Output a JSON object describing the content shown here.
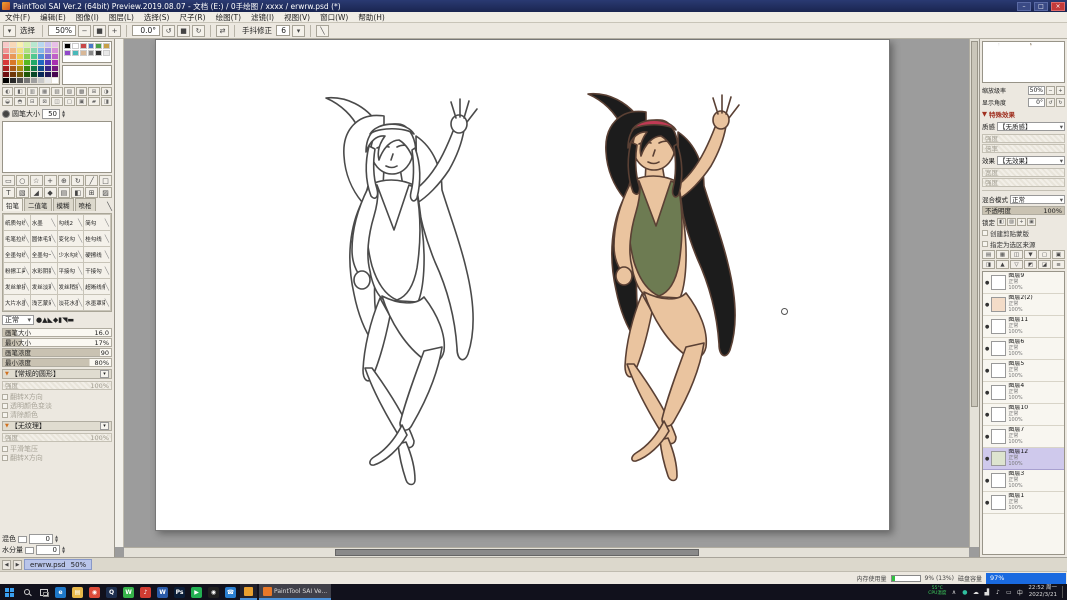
{
  "window": {
    "title": "PaintTool SAI Ver.2 (64bit) Preview.2019.08.07 - 文档 (E:) / 0手绘图 / xxxx / erwrw.psd (*)",
    "controls": {
      "minimize": "–",
      "maximize": "□",
      "close": "×"
    }
  },
  "menu": {
    "items": [
      "文件(F)",
      "编辑(E)",
      "图像(I)",
      "图层(L)",
      "选择(S)",
      "尺子(R)",
      "绘图(T)",
      "滤镜(I)",
      "视图(V)",
      "窗口(W)",
      "帮助(H)"
    ]
  },
  "toolbar": {
    "select_label": "选择",
    "zoom_value": "50%",
    "zoom_buttons": [
      "−",
      "■",
      "+"
    ],
    "angle_value": "0.0°",
    "angle_buttons": [
      "↺",
      "■",
      "↻"
    ],
    "stabilizer_label": "手抖修正",
    "stabilizer_value": "6"
  },
  "left_panel": {
    "palette_colors": [
      "#f8c8c8",
      "#f8d8b8",
      "#f8f0b0",
      "#d8f0b0",
      "#b8e8d0",
      "#b8d8f0",
      "#c8c0f0",
      "#e8c0e8",
      "#f09898",
      "#f0b888",
      "#f0e080",
      "#b0e080",
      "#88d8b0",
      "#88b8e8",
      "#a090e0",
      "#d890d8",
      "#e86868",
      "#e89858",
      "#e8d050",
      "#88d050",
      "#50c890",
      "#5090d8",
      "#7868d0",
      "#c060c8",
      "#d83838",
      "#d87828",
      "#d8b820",
      "#58b820",
      "#20a868",
      "#2068c0",
      "#5038b8",
      "#a830b0",
      "#a82020",
      "#a85818",
      "#a88810",
      "#388810",
      "#107848",
      "#104888",
      "#382888",
      "#781880",
      "#701010",
      "#703808",
      "#705808",
      "#205808",
      "#084828",
      "#082858",
      "#201858",
      "#480850",
      "#000000",
      "#282828",
      "#505050",
      "#787878",
      "#a0a0a0",
      "#c8c8c8",
      "#e8e8e8",
      "#ffffff"
    ],
    "mixer_colors": [
      "#000000",
      "#ffffff",
      "#c84848",
      "#4878c8",
      "#48a048",
      "#c8a048",
      "#9048c8",
      "#48b8b8",
      "#d8b898",
      "#888888",
      "#303030",
      "#e8e8e8"
    ],
    "utility_buttons": [
      {
        "name": "hue-ring-button",
        "glyph": "◐"
      },
      {
        "name": "hue-square-button",
        "glyph": "◧"
      },
      {
        "name": "slider-rgb-button",
        "glyph": "▥"
      },
      {
        "name": "slider-hsv-button",
        "glyph": "▦"
      },
      {
        "name": "swatch-panel-button",
        "glyph": "▧"
      },
      {
        "name": "mixer-panel-button",
        "glyph": "▨"
      },
      {
        "name": "paper-panel-button",
        "glyph": "▩"
      },
      {
        "name": "scratchpad-button",
        "glyph": "⊞"
      },
      {
        "name": "picker-button",
        "glyph": "◑"
      },
      {
        "name": "gray-scale-button",
        "glyph": "◒"
      },
      {
        "name": "tone-button",
        "glyph": "◓"
      },
      {
        "name": "grid-a-button",
        "glyph": "⊟"
      },
      {
        "name": "grid-b-button",
        "glyph": "⊠"
      },
      {
        "name": "grid-c-button",
        "glyph": "◫"
      },
      {
        "name": "grid-d-button",
        "glyph": "▢"
      },
      {
        "name": "grid-e-button",
        "glyph": "▣"
      },
      {
        "name": "grid-f-button",
        "glyph": "▰"
      },
      {
        "name": "grid-g-button",
        "glyph": "◨"
      }
    ],
    "brush_size_label": "圆笔大小",
    "brush_size_value": "50",
    "tools": [
      {
        "name": "selection-rect-tool",
        "glyph": "▭"
      },
      {
        "name": "lasso-tool",
        "glyph": "○"
      },
      {
        "name": "magic-wand-tool",
        "glyph": "☆"
      },
      {
        "name": "move-tool",
        "glyph": "+"
      },
      {
        "name": "zoom-tool",
        "glyph": "⊕"
      },
      {
        "name": "rotate-tool",
        "glyph": "↻"
      },
      {
        "name": "pen-tool",
        "glyph": "╱"
      },
      {
        "name": "eraser-tool",
        "glyph": "□"
      },
      {
        "name": "text-tool",
        "glyph": "T"
      },
      {
        "name": "gradient-tool",
        "glyph": "▧"
      },
      {
        "name": "bucket-tool",
        "glyph": "◢"
      },
      {
        "name": "shape-tool",
        "glyph": "◆"
      },
      {
        "name": "panel-a-tool",
        "glyph": "▤"
      },
      {
        "name": "panel-b-tool",
        "glyph": "◧"
      },
      {
        "name": "panel-c-tool",
        "glyph": "⊞"
      },
      {
        "name": "panel-d-tool",
        "glyph": "▨"
      }
    ],
    "brush_tabs": [
      "铅笔",
      "二值笔",
      "模糊",
      "喷枪"
    ],
    "brushes": [
      "纸质勾线",
      "水墨",
      "勾线2",
      "简勾",
      "毛笔拉线",
      "圆体毛笔",
      "变化勾",
      "桂勾线",
      "全墨勾线",
      "全墨勾一",
      "少水勾线",
      "硬擦线",
      "粉擦工具",
      "水彩阴影",
      "平接勾",
      "干接勾",
      "发丝单接",
      "发丝淡彩",
      "发丝稍接",
      "超晰线条",
      "大片水墨",
      "浅艺蒙染",
      "淡花水墨",
      "水墨罩染"
    ],
    "tip_mode": "正常",
    "tip_shapes": [
      "●",
      "▲",
      "◣",
      "◆",
      "▮",
      "◥",
      "▬"
    ],
    "sliders": [
      {
        "label": "画笔大小",
        "value": "16.0",
        "fill": 12
      },
      {
        "label": "最小大小",
        "value": "17%",
        "fill": 17
      },
      {
        "label": "画笔浓度",
        "value": "90",
        "fill": 90
      },
      {
        "label": "最小浓度",
        "value": "80%",
        "fill": 80
      }
    ],
    "shape_section": {
      "title": "【常规的圆形】",
      "strength_label": "强度",
      "strength_value": "100%",
      "options": [
        "翻转X方向",
        "透明颜色变淡",
        "清除颜色"
      ]
    },
    "texture_section": {
      "title": "【无纹理】",
      "strength_label": "强度",
      "strength_value": "100%",
      "options": [
        "平滑笔压",
        "翻转X方向"
      ]
    },
    "mix_label": "混色",
    "mix_value": "0",
    "water_label": "水分量",
    "water_value": "0"
  },
  "canvas": {
    "artwork_description": "两个跳跃姿势的长发女性人物：左侧为铅笔线稿，右侧为上色稿（黑发、红色发带、绿色连体泳衣）",
    "colors": {
      "hair": "#1c1c1c",
      "skin": "#eac49f",
      "swimsuit": "#6d7b52",
      "headband": "#c13a55",
      "lineart": "#4a4a4a"
    }
  },
  "right_panel": {
    "navigator": {
      "zoom_label": "缩放级率",
      "zoom_value": "50%",
      "angle_label": "显示角度",
      "angle_value": "0°"
    },
    "effects": {
      "header": "特殊效果",
      "texture_label": "质感",
      "texture_value": "【无质感】",
      "texture_rows": [
        {
          "label": "强度"
        },
        {
          "label": "倍率"
        }
      ],
      "effect_label": "效果",
      "effect_value": "【无效果】",
      "effect_rows": [
        {
          "label": "宽度"
        },
        {
          "label": "强度"
        }
      ]
    },
    "layer_props": {
      "blend_label": "混合模式",
      "blend_value": "正常",
      "opacity_label": "不透明度",
      "opacity_value": "100%",
      "lock_label": "锁定",
      "clip_label": "创建剪贴蒙版",
      "selsrc_label": "指定为选区来源"
    },
    "lock_icons": [
      {
        "name": "lock-transparency-icon",
        "glyph": "◧"
      },
      {
        "name": "lock-pixels-icon",
        "glyph": "▨"
      },
      {
        "name": "lock-position-icon",
        "glyph": "+"
      },
      {
        "name": "lock-all-icon",
        "glyph": "▣"
      }
    ],
    "layer_toolbar": [
      {
        "name": "new-layer-button",
        "glyph": "▤"
      },
      {
        "name": "new-folder-button",
        "glyph": "▦"
      },
      {
        "name": "duplicate-layer-button",
        "glyph": "◫"
      },
      {
        "name": "merge-down-button",
        "glyph": "▼"
      },
      {
        "name": "clear-layer-button",
        "glyph": "▢"
      },
      {
        "name": "delete-layer-button",
        "glyph": "▣"
      },
      {
        "name": "layer-mask-button",
        "glyph": "◨"
      },
      {
        "name": "move-layer-up-button",
        "glyph": "▲"
      },
      {
        "name": "move-layer-down-button",
        "glyph": "▽"
      },
      {
        "name": "lock-alpha-button",
        "glyph": "◩"
      },
      {
        "name": "paint-effect-button",
        "glyph": "◪"
      },
      {
        "name": "layer-settings-button",
        "glyph": "≡"
      }
    ],
    "layers": [
      {
        "name": "图层9",
        "mode": "正常",
        "opacity": "100%",
        "thumb": "#ffffff",
        "selected": false
      },
      {
        "name": "图层2(2)",
        "mode": "正常",
        "opacity": "100%",
        "thumb": "#f3dcc8",
        "selected": false
      },
      {
        "name": "图层11",
        "mode": "正常",
        "opacity": "100%",
        "thumb": "#ffffff",
        "selected": false
      },
      {
        "name": "图层6",
        "mode": "正常",
        "opacity": "100%",
        "thumb": "#ffffff",
        "selected": false
      },
      {
        "name": "图层5",
        "mode": "正常",
        "opacity": "100%",
        "thumb": "#ffffff",
        "selected": false
      },
      {
        "name": "图层4",
        "mode": "正常",
        "opacity": "100%",
        "thumb": "#ffffff",
        "selected": false
      },
      {
        "name": "图层10",
        "mode": "正常",
        "opacity": "100%",
        "thumb": "#ffffff",
        "selected": false
      },
      {
        "name": "图层7",
        "mode": "正常",
        "opacity": "100%",
        "thumb": "#ffffff",
        "selected": false
      },
      {
        "name": "图层12",
        "mode": "正常",
        "opacity": "100%",
        "thumb": "#dde4cf",
        "selected": true
      },
      {
        "name": "图层3",
        "mode": "正常",
        "opacity": "100%",
        "thumb": "#ffffff",
        "selected": false
      },
      {
        "name": "图层1",
        "mode": "正常",
        "opacity": "100%",
        "thumb": "#ffffff",
        "selected": false
      }
    ]
  },
  "status_bar": {
    "doc_name": "erwrw.psd",
    "doc_zoom": "50%",
    "memory_label": "内存使用量",
    "memory_value": "9% (13%)",
    "disk_label": "磁盘容量",
    "disk_value": "97%"
  },
  "taskbar": {
    "apps": [
      {
        "name": "edge-icon",
        "color": "#1e78c8",
        "glyph": "e"
      },
      {
        "name": "file-explorer-icon",
        "color": "#e8b84a",
        "glyph": "▤"
      },
      {
        "name": "chrome-icon",
        "color": "#dd4b39",
        "glyph": "◉"
      },
      {
        "name": "qq-icon",
        "color": "#1d2e4e",
        "glyph": "Q"
      },
      {
        "name": "wechat-icon",
        "color": "#36b34a",
        "glyph": "W"
      },
      {
        "name": "netease-music-icon",
        "color": "#d23c32",
        "glyph": "♪"
      },
      {
        "name": "word-icon",
        "color": "#2a5aa8",
        "glyph": "W"
      },
      {
        "name": "photoshop-icon",
        "color": "#0c1e38",
        "glyph": "Ps"
      },
      {
        "name": "video-player-icon",
        "color": "#22b052",
        "glyph": "▶"
      },
      {
        "name": "github-icon",
        "color": "#202020",
        "glyph": "◉"
      },
      {
        "name": "phone-link-icon",
        "color": "#2a7fd0",
        "glyph": "☎"
      }
    ],
    "windows": [
      {
        "name": "image-viewer-window-button",
        "color": "#e8a030",
        "label": "",
        "active": false
      },
      {
        "name": "sai-window-button",
        "color": "#e87828",
        "label": "PaintTool SAI Ve...",
        "active": true
      }
    ],
    "tray": {
      "badge_line1": "55°C",
      "badge_line2": "CPU温度",
      "icons": [
        {
          "name": "hidden-icons-chevron",
          "glyph": "∧",
          "color": "#dddddd"
        },
        {
          "name": "tray-security-icon",
          "glyph": "●",
          "color": "#30c0a0"
        },
        {
          "name": "tray-cloud-icon",
          "glyph": "☁",
          "color": "#dddddd"
        },
        {
          "name": "network-icon",
          "glyph": "▟",
          "color": "#dddddd"
        },
        {
          "name": "volume-icon",
          "glyph": "♪",
          "color": "#dddddd"
        },
        {
          "name": "battery-icon",
          "glyph": "▭",
          "color": "#dddddd"
        }
      ],
      "lang": "中",
      "time_line1": "22:52 周一",
      "time_line2": "2022/3/21"
    }
  }
}
